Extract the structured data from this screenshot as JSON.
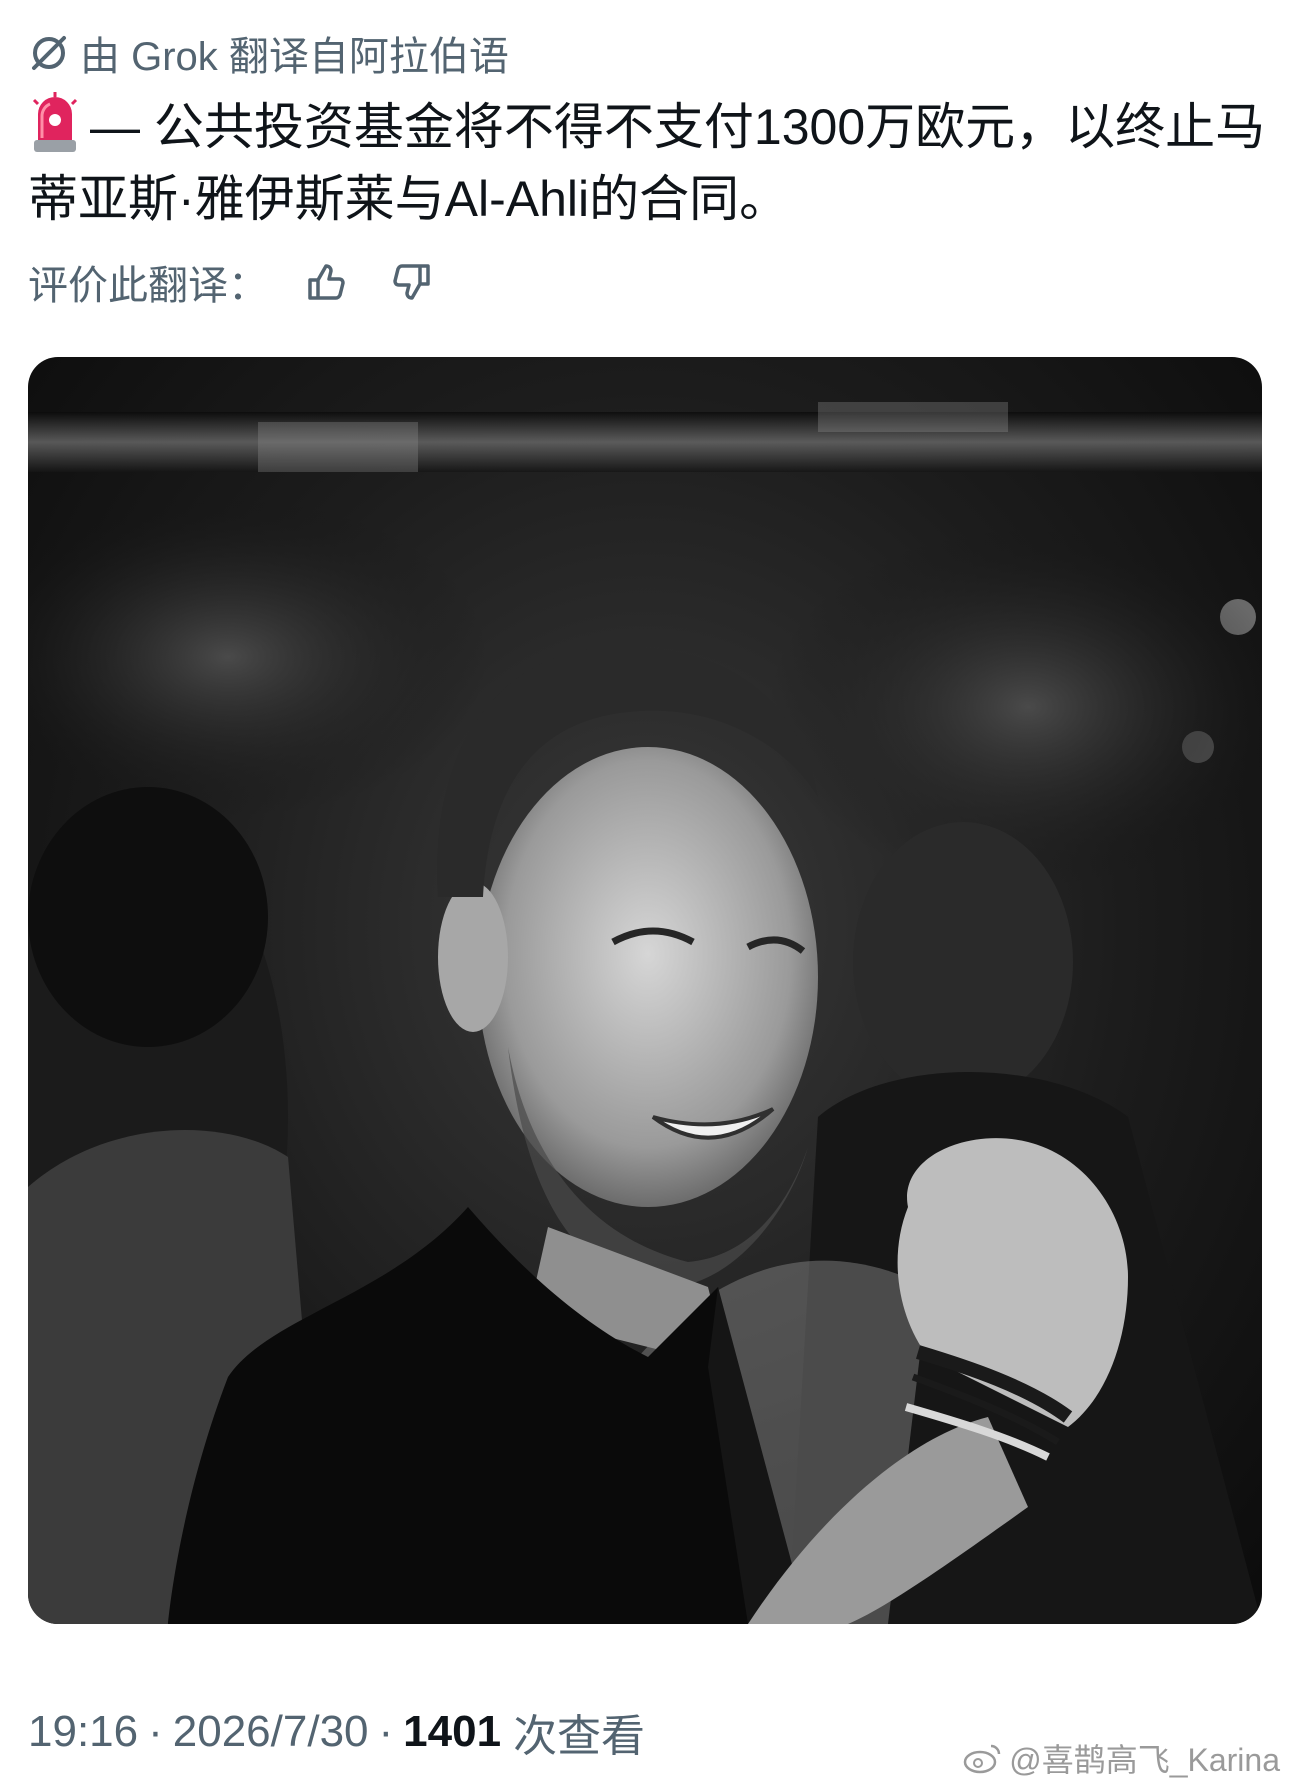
{
  "translation_notice": "由 Grok 翻译自阿拉伯语",
  "post": {
    "text": "— 公共投资基金将不得不支付1300万欧元，以终止马蒂亚斯·雅伊斯莱与Al-Ahli的合同。",
    "emoji_icon": "police-siren-icon"
  },
  "rating": {
    "label": "评价此翻译：",
    "up_icon": "thumbs-up-icon",
    "down_icon": "thumbs-down-icon"
  },
  "photo": {
    "description_icon": "photo"
  },
  "meta": {
    "time": "19:16",
    "separator": "·",
    "date": "2026/7/30",
    "views_count": "1401",
    "views_label": "次查看"
  },
  "watermark": {
    "text": "@喜鹊高飞_Karina",
    "logo_icon": "weibo-logo"
  }
}
